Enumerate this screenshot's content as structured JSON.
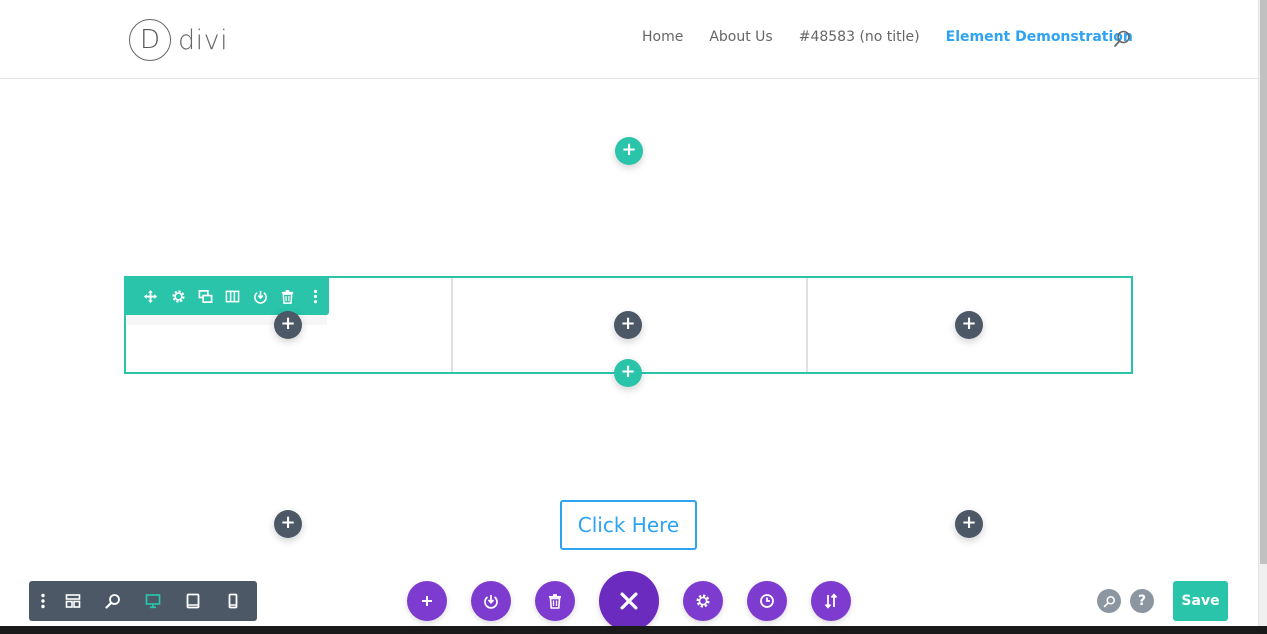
{
  "header": {
    "logo_letter": "D",
    "logo_text": "divi",
    "nav": [
      {
        "label": "Home"
      },
      {
        "label": "About Us"
      },
      {
        "label": "#48583 (no title)"
      },
      {
        "label": "Element Demonstration",
        "active": true
      }
    ],
    "search_icon": "search-icon"
  },
  "builder": {
    "add_symbol": "+",
    "row_toolbar_icons": [
      "move-icon",
      "gear-icon",
      "duplicate-icon",
      "columns-icon",
      "save-to-library-icon",
      "trash-icon",
      "more-options-icon"
    ],
    "cta_label": "Click Here"
  },
  "bottom_bar": {
    "view_modes": [
      "more-options-icon",
      "wireframe-view-icon",
      "zoom-icon",
      "desktop-view-icon",
      "tablet-view-icon",
      "phone-view-icon"
    ],
    "active_view": "desktop-view-icon",
    "center_actions": [
      "add-icon",
      "load-from-library-icon",
      "clear-layout-icon",
      "close-icon",
      "page-settings-icon",
      "history-icon",
      "portability-icon"
    ],
    "right_actions": [
      "search-icon",
      "help-icon"
    ],
    "help_label": "?",
    "save_label": "Save"
  },
  "colors": {
    "teal": "#29c4a9",
    "dark": "#4c5866",
    "purple": "#7d3bcf",
    "link_blue": "#2ea3f2"
  }
}
